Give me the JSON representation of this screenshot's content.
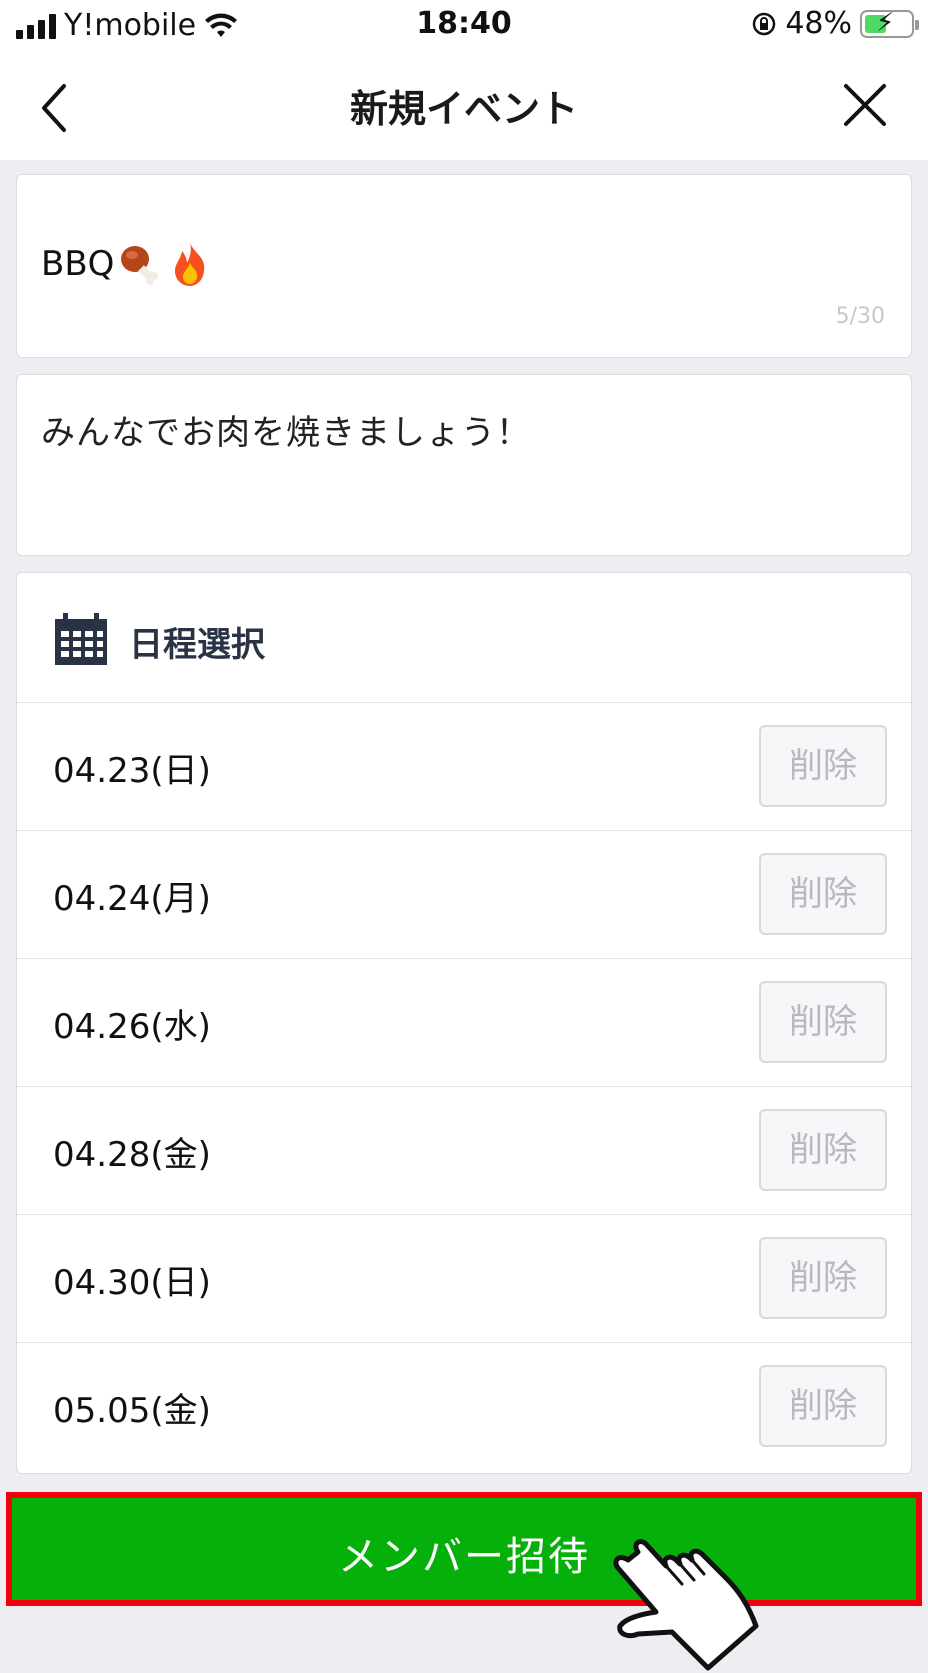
{
  "status_bar": {
    "carrier": "Y!mobile",
    "time": "18:40",
    "battery": "48%",
    "battery_level": 0.48
  },
  "nav": {
    "title": "新規イベント",
    "back_icon": "chevron-left-icon",
    "close_icon": "close-icon"
  },
  "event": {
    "title_value": "BBQ",
    "title_emojis": [
      "meat-on-bone-icon",
      "fire-icon"
    ],
    "title_counter": "5/30",
    "description_value": "みんなでお肉を焼きましょう！"
  },
  "schedule": {
    "header_icon": "calendar-icon",
    "header_title": "日程選択",
    "dates": [
      {
        "date": "04.23(日)",
        "delete_label": "削除"
      },
      {
        "date": "04.24(月)",
        "delete_label": "削除"
      },
      {
        "date": "04.26(水)",
        "delete_label": "削除"
      },
      {
        "date": "04.28(金)",
        "delete_label": "削除"
      },
      {
        "date": "04.30(日)",
        "delete_label": "削除"
      },
      {
        "date": "05.05(金)",
        "delete_label": "削除"
      }
    ]
  },
  "invite_button": {
    "label": "メンバー招待"
  },
  "colors": {
    "accent_green": "#06b00a",
    "highlight_red": "#f2000c",
    "background": "#ededf2",
    "header_text": "#2a3245"
  }
}
